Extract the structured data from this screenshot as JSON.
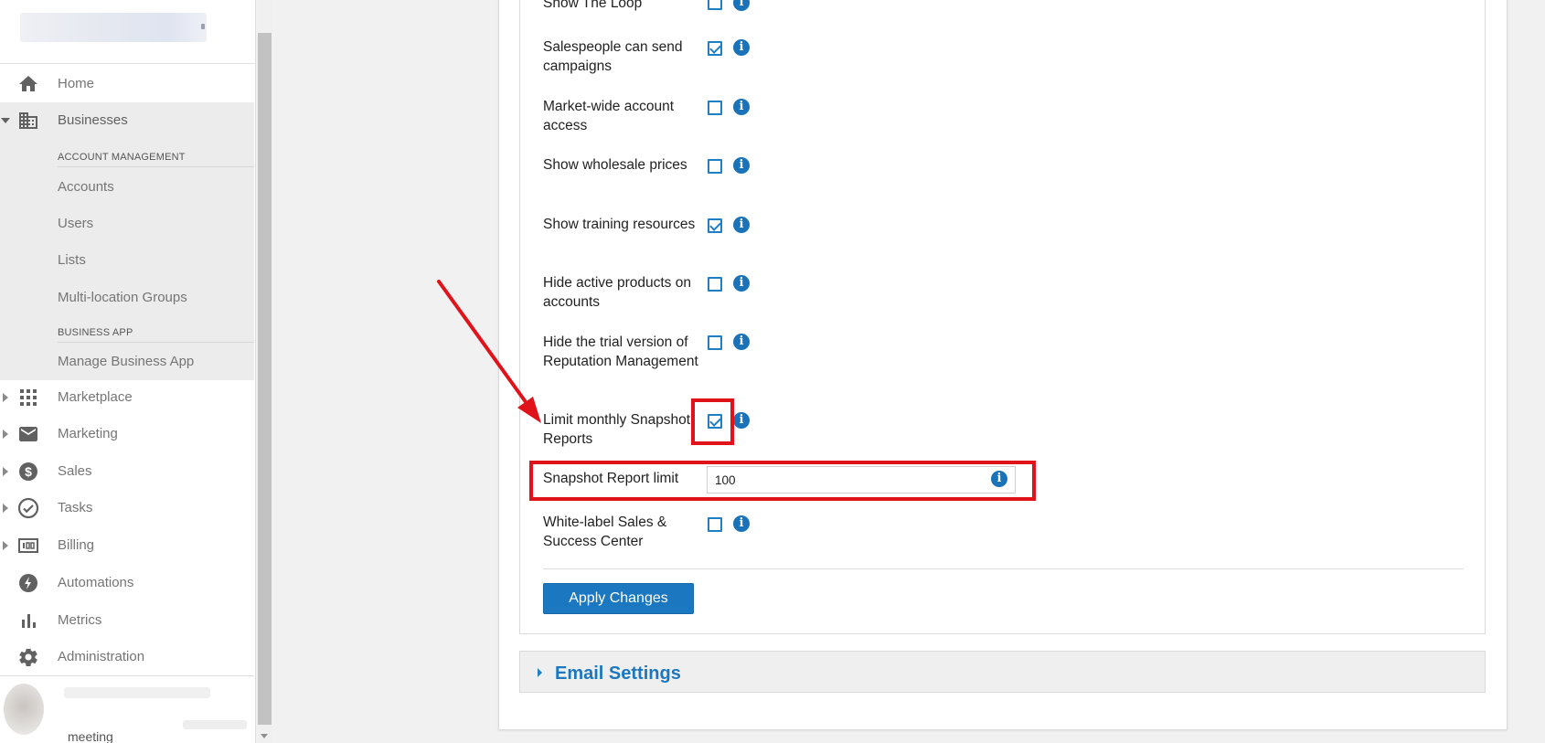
{
  "sidebar": {
    "nav": [
      {
        "label": "Home",
        "icon": "home-icon"
      },
      {
        "label": "Businesses",
        "icon": "business-icon",
        "expanded": true
      },
      {
        "label": "Marketplace",
        "icon": "apps-grid-icon"
      },
      {
        "label": "Marketing",
        "icon": "envelope-icon"
      },
      {
        "label": "Sales",
        "icon": "dollar-icon"
      },
      {
        "label": "Tasks",
        "icon": "check-circle-icon"
      },
      {
        "label": "Billing",
        "icon": "billing-icon"
      },
      {
        "label": "Automations",
        "icon": "bolt-icon"
      },
      {
        "label": "Metrics",
        "icon": "bar-chart-icon"
      },
      {
        "label": "Administration",
        "icon": "gear-icon"
      }
    ],
    "account_management_header": "ACCOUNT MANAGEMENT",
    "account_items": [
      "Accounts",
      "Users",
      "Lists",
      "Multi-location Groups"
    ],
    "business_app_header": "BUSINESS APP",
    "business_app_items": [
      "Manage Business App"
    ],
    "footer_text": "meeting"
  },
  "settings": {
    "rows": [
      {
        "label": "Show The Loop",
        "checked": false
      },
      {
        "label": "Salespeople can send campaigns",
        "checked": true
      },
      {
        "label": "Market-wide account access",
        "checked": false
      },
      {
        "label": "Show wholesale prices",
        "checked": false
      },
      {
        "label": "Show training resources",
        "checked": true
      },
      {
        "label": "Hide active products on accounts",
        "checked": false
      },
      {
        "label": "Hide the trial version of Reputation Management",
        "checked": false
      },
      {
        "label": "Limit monthly Snapshot Reports",
        "checked": true
      }
    ],
    "snapshot_limit_label": "Snapshot Report limit",
    "snapshot_limit_value": "100",
    "white_label_label": "White-label Sales & Success Center",
    "white_label_checked": false,
    "apply_button": "Apply Changes"
  },
  "email_settings": {
    "label": "Email Settings"
  },
  "colors": {
    "accent": "#1a77c0",
    "annotation": "#e0121a"
  }
}
